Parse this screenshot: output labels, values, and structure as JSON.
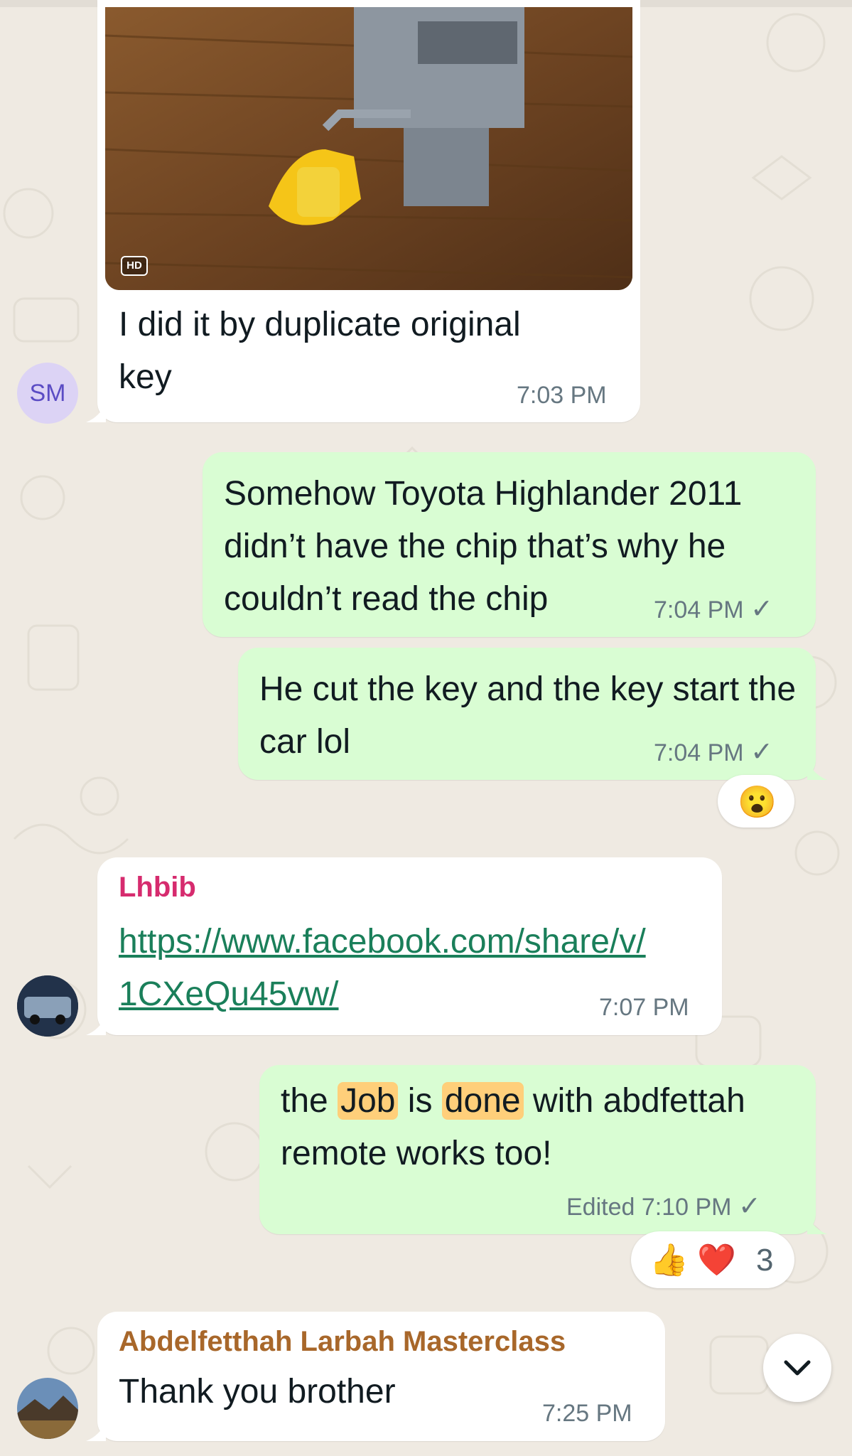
{
  "messages": {
    "m1": {
      "caption": "I did it by duplicate original key",
      "time": "7:03 PM",
      "hd_badge": "HD"
    },
    "sm_avatar": {
      "initials": "SM"
    },
    "m2": {
      "text": "Somehow Toyota Highlander 2011 didn’t have the chip that’s why he couldn’t read the chip",
      "time": "7:04 PM",
      "status": "✓"
    },
    "m3": {
      "text": "He cut the key and the key start the car lol",
      "time": "7:04 PM",
      "status": "✓",
      "reaction": "😮"
    },
    "m4": {
      "sender": "Lhbib",
      "link_line1": "https://www.facebook.com/share/v/",
      "link_line2": "1CXeQu45vw/",
      "time": "7:07 PM",
      "sender_color": "#d62b6e"
    },
    "m5": {
      "text_pre": "the ",
      "hl1": "Job",
      "text_mid": " is ",
      "hl2": "done",
      "text_post": " with abdfettah remote works too!",
      "edited": "Edited",
      "time": "7:10 PM",
      "status": "✓",
      "reaction_emojis": "👍 ❤️",
      "reaction_count": "3"
    },
    "m6": {
      "sender": "Abdelfetthah Larbah Masterclass",
      "text": "Thank you brother",
      "time": "7:25 PM",
      "sender_color": "#a8672a"
    }
  },
  "icons": {
    "scroll_down": "chevron-down-icon",
    "read_receipt": "check-icon"
  },
  "colors": {
    "outgoing_bubble": "#d9fdd3",
    "incoming_bubble": "#ffffff",
    "background": "#efeae2",
    "highlight": "#ffcf7a"
  }
}
